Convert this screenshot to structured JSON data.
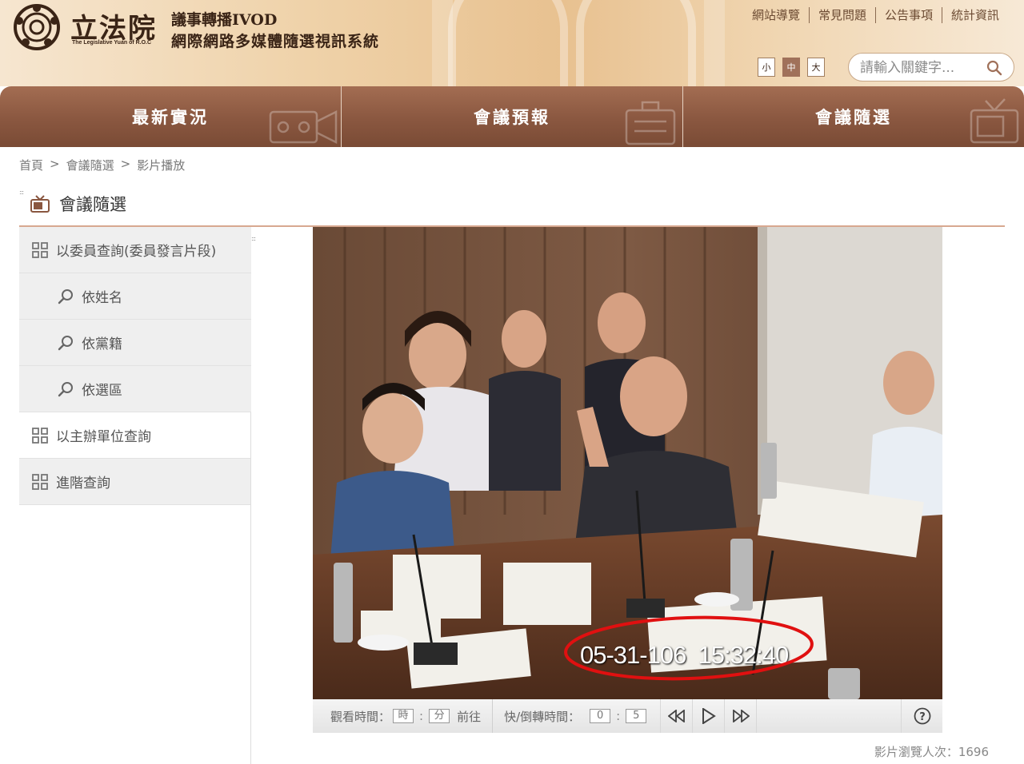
{
  "header": {
    "logo_cn": "立法院",
    "logo_en": "The Legislative Yuan of R.O.C",
    "system_line1": "議事轉播IVOD",
    "system_line2": "網際網路多媒體隨選視訊系統",
    "links": [
      "網站導覽",
      "常見問題",
      "公告事項",
      "統計資訊"
    ],
    "font_sizes": [
      "小",
      "中",
      "大"
    ],
    "search_placeholder": "請輸入關鍵字..."
  },
  "nav": {
    "tabs": [
      "最新實況",
      "會議預報",
      "會議隨選"
    ]
  },
  "breadcrumb": {
    "items": [
      "首頁",
      "會議隨選",
      "影片播放"
    ],
    "separator": ">"
  },
  "page_title": "會議隨選",
  "sidebar": {
    "group1": "以委員查詢(委員發言片段)",
    "sub_items": [
      "依姓名",
      "依黨籍",
      "依選區"
    ],
    "group2": "以主辦單位查詢",
    "group3": "進階查詢"
  },
  "video": {
    "timestamp_overlay": "05-31-106  15:32:40"
  },
  "controls": {
    "watch_time_label": "觀看時間：",
    "hour_placeholder": "時",
    "minute_placeholder": "分",
    "goto_label": "前往",
    "seek_label": "快/倒轉時間：",
    "seek_min": "0",
    "seek_sec": "5"
  },
  "view_count_label": "影片瀏覽人次：1696",
  "colors": {
    "nav_brown": "#8a5740",
    "accent_line": "#d8a890",
    "annotation_red": "#e01010"
  }
}
